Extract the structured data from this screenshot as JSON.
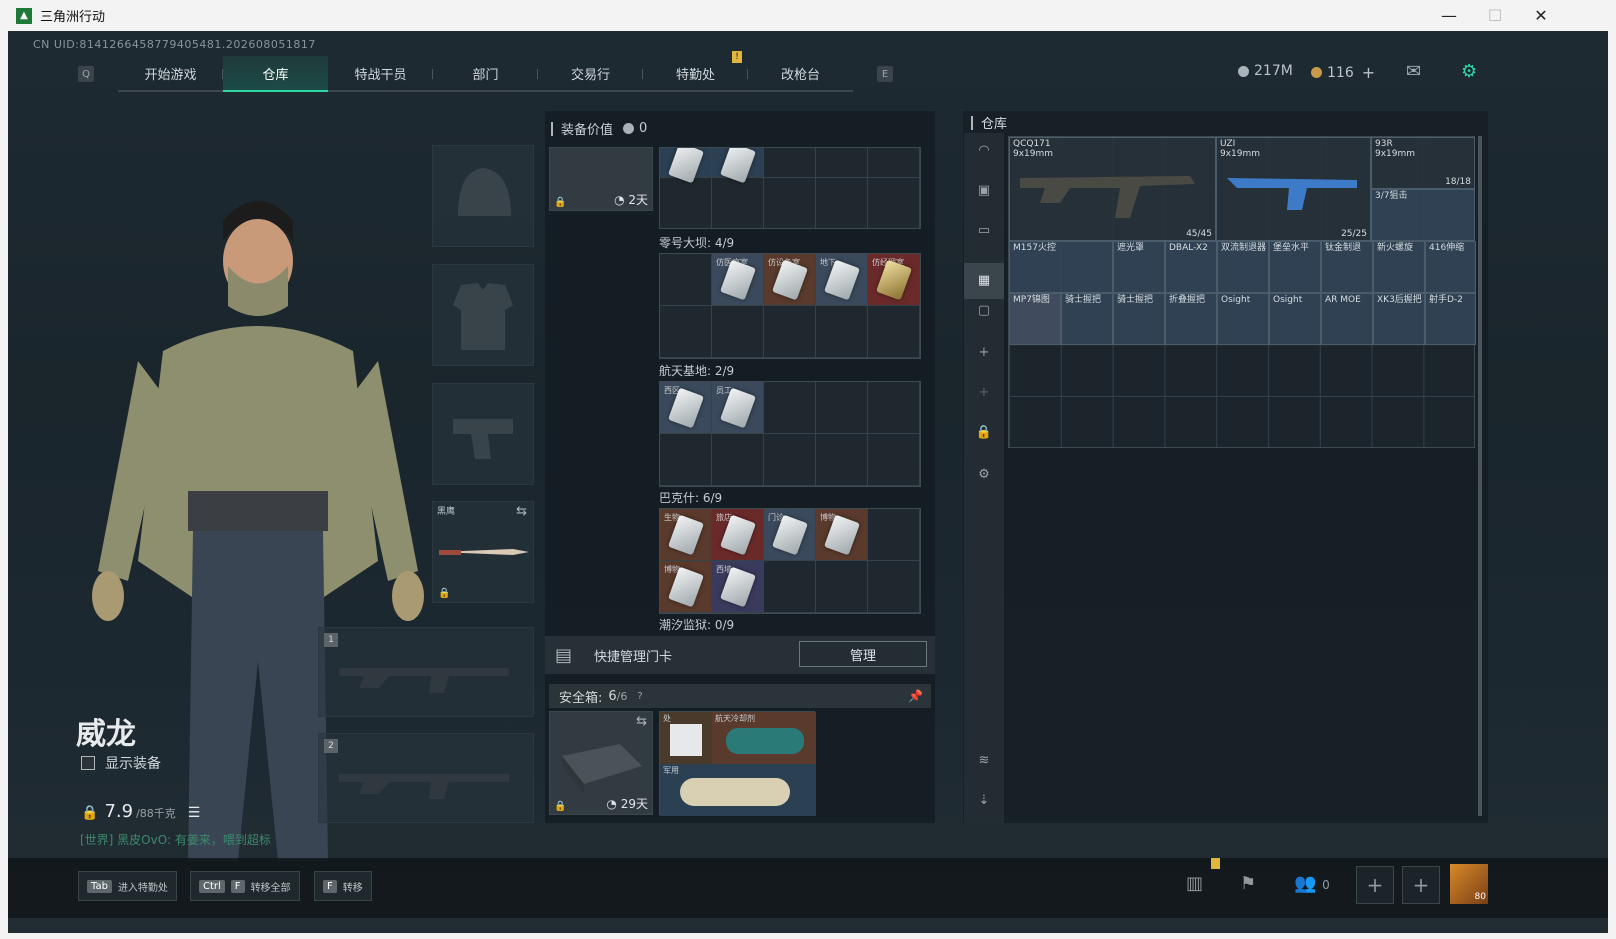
{
  "window": {
    "title": "三角洲行动",
    "minimize": "—",
    "maximize": "☐",
    "close": "✕"
  },
  "uid": "CN UID:8141266458779405481.202608051817",
  "nav": {
    "left_key": "Q",
    "right_key": "E",
    "tabs": [
      "开始游戏",
      "仓库",
      "特战干员",
      "部门",
      "交易行",
      "特勤处",
      "改枪台"
    ],
    "alert": "!"
  },
  "currency": {
    "havoc": "217M",
    "coin": "116",
    "plus": "+"
  },
  "character": {
    "name": "威龙",
    "show_equipment": "显示装备",
    "weight": "7.9",
    "weight_cap": "/88千克",
    "chat": "[世界] 黑皮OvO: 有姜来，喂到超标"
  },
  "equip_slots": {
    "melee_label": "黑鹰",
    "weapon1": "1",
    "weapon2": "2"
  },
  "mid": {
    "value_label": "装备价值",
    "value": "0",
    "bag_timer": "2天",
    "sections": [
      {
        "label": "零号大坝: 4/9",
        "cards": [
          "仿医疗室",
          "仿设备室",
          "地下",
          "仿经理室"
        ]
      },
      {
        "label": "航天基地: 2/9",
        "cards": [
          "西区",
          "员工"
        ]
      },
      {
        "label": "巴克什: 6/9",
        "cards": [
          "生物",
          "旅店",
          "门诊",
          "博物",
          "博物",
          "西墙"
        ]
      },
      {
        "label": "潮汐监狱: 0/9",
        "cards": []
      }
    ],
    "quick": "快捷管理门卡",
    "manage": "管理",
    "safe_label": "安全箱:",
    "safe_count": "6",
    "safe_total": "/6",
    "safe_help": "?",
    "safe_timer": "29天",
    "safe_items": [
      "处",
      "航天冷却剂",
      "军用"
    ]
  },
  "stash": {
    "title": "仓库",
    "items": [
      {
        "name": "QCQ171\n9x19mm",
        "count": "45/45"
      },
      {
        "name": "UZI\n9x19mm",
        "count": "25/25"
      },
      {
        "name": "93R\n9x19mm",
        "count": "18/18"
      },
      {
        "name": "3/7狙击",
        "count": ""
      },
      {
        "name": "M157火控",
        "count": ""
      },
      {
        "name": "遮光罩",
        "count": ""
      },
      {
        "name": "DBAL-X2",
        "count": ""
      },
      {
        "name": "双流制退器",
        "count": ""
      },
      {
        "name": "堡垒水平",
        "count": ""
      },
      {
        "name": "钛金制退",
        "count": ""
      },
      {
        "name": "新火螺旋",
        "count": ""
      },
      {
        "name": "416伸缩",
        "count": ""
      },
      {
        "name": "MP7锦图",
        "count": ""
      },
      {
        "name": "骑士握把",
        "count": ""
      },
      {
        "name": "骑士握把",
        "count": ""
      },
      {
        "name": "折叠握把",
        "count": ""
      },
      {
        "name": "Osight",
        "count": ""
      },
      {
        "name": "Osight",
        "count": ""
      },
      {
        "name": "AR MOE",
        "count": ""
      },
      {
        "name": "XK3后握把",
        "count": ""
      },
      {
        "name": "射手D-2",
        "count": ""
      }
    ]
  },
  "bottom": {
    "k1": "Tab",
    "k1_text": "进入特勤处",
    "k2a": "Ctrl",
    "k2b": "F",
    "k2_text": "转移全部",
    "k3": "F",
    "k3_text": "转移",
    "friends": "0",
    "level": "80"
  }
}
